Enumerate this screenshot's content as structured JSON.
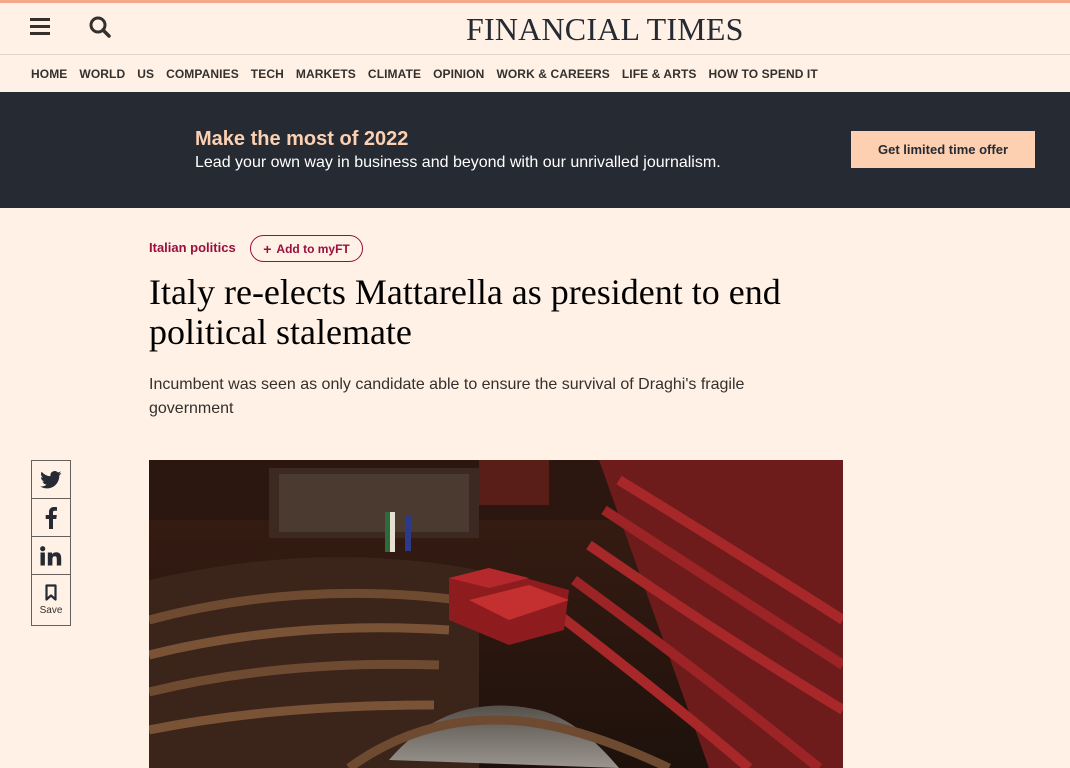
{
  "header": {
    "logo": "FINANCIAL TIMES",
    "menu_icon": "hamburger-menu-icon",
    "search_icon": "search-icon"
  },
  "nav": {
    "items": [
      "HOME",
      "WORLD",
      "US",
      "COMPANIES",
      "TECH",
      "MARKETS",
      "CLIMATE",
      "OPINION",
      "WORK & CAREERS",
      "LIFE & ARTS",
      "HOW TO SPEND IT"
    ]
  },
  "banner": {
    "title": "Make the most of 2022",
    "text": "Lead your own way in business and beyond with our unrivalled journalism.",
    "button": "Get limited time offer"
  },
  "article": {
    "topic": "Italian politics",
    "myft_button": "Add to myFT",
    "headline": "Italy re-elects Mattarella as president to end political stalemate",
    "standfirst": "Incumbent was seen as only candidate able to ensure the survival of Draghi's fragile government"
  },
  "share": {
    "save_label": "Save",
    "icons": [
      "twitter-icon",
      "facebook-icon",
      "linkedin-icon",
      "bookmark-icon"
    ]
  },
  "colors": {
    "page_background": "#fff1e5",
    "banner_background": "#262a33",
    "banner_accent": "#fcd0b1",
    "topic_claret": "#990f3d"
  }
}
